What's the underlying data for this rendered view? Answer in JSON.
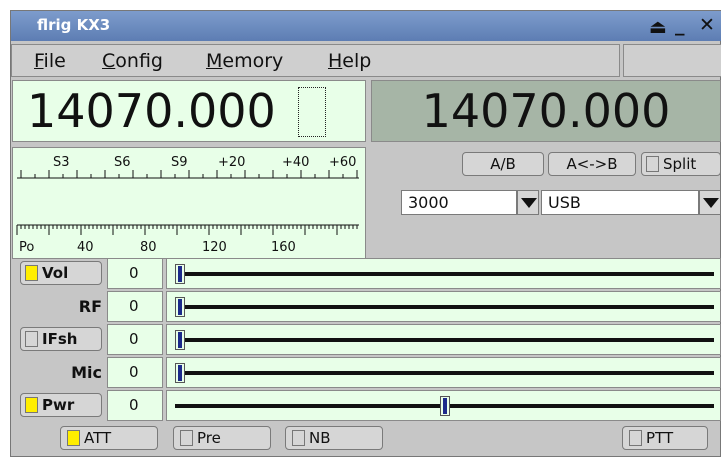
{
  "window": {
    "title": "flrig KX3",
    "icons": [
      "eject-icon",
      "minimize-icon",
      "close-icon"
    ]
  },
  "menu": {
    "file": "File",
    "config": "Config",
    "memory": "Memory",
    "help": "Help"
  },
  "freq": {
    "vfo_a": "14070.000",
    "vfo_b": "14070.000"
  },
  "meter": {
    "s_scale": [
      "S3",
      "S6",
      "S9",
      "+20",
      "+40",
      "+60"
    ],
    "po_label": "Po",
    "po_scale": [
      "40",
      "80",
      "120",
      "160"
    ]
  },
  "buttons": {
    "ab": "A/B",
    "swap": "A<->B",
    "split": "Split"
  },
  "bandwidth": {
    "value": "3000"
  },
  "mode": {
    "value": "USB"
  },
  "sliders": [
    {
      "label": "Vol",
      "value": "0",
      "level": 0,
      "checkbox": true,
      "checked": true
    },
    {
      "label": "RF",
      "value": "0",
      "level": 0
    },
    {
      "label": "IFsh",
      "value": "0",
      "level": 0,
      "checkbox": true,
      "checked": false
    },
    {
      "label": "Mic",
      "value": "0",
      "level": 0
    },
    {
      "label": "Pwr",
      "value": "0",
      "level": 0.5,
      "checkbox": true,
      "checked": true
    }
  ],
  "toggles": {
    "att": "ATT",
    "pre": "Pre",
    "nb": "NB",
    "ptt": "PTT"
  },
  "colors": {
    "panel": "#e8ffe8",
    "vfo_b_bg": "#a6b5a6",
    "active_check": "#ffee00",
    "titlebar": "#5d7db3"
  }
}
